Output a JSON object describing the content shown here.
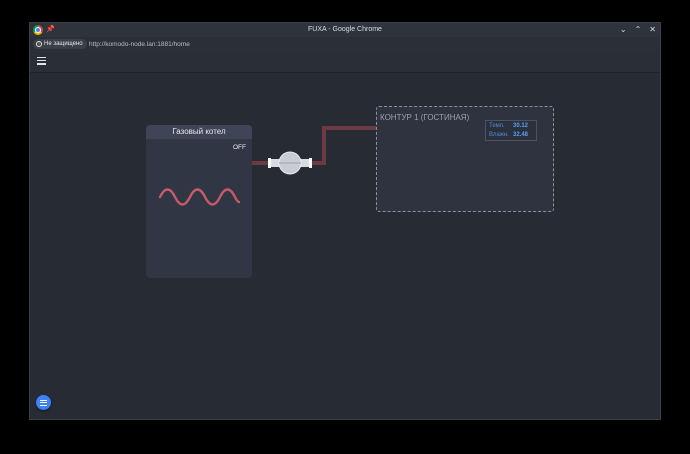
{
  "window": {
    "title": "FUXA - Google Chrome",
    "controls": {
      "minimize": "⌄",
      "restore": "⌃",
      "close": "✕"
    }
  },
  "addressbar": {
    "security_label": "Не защищено",
    "security_icon": "info-circle-icon",
    "url": "http://komodo-node.lan:1881/home"
  },
  "toolbar": {
    "menu_icon": "hamburger-menu-icon"
  },
  "boiler": {
    "title": "Газовый котел",
    "status": "OFF"
  },
  "contour": {
    "title": "КОНТУР 1 (ГОСТИНАЯ)",
    "sensors": [
      {
        "label": "Темп.",
        "value": "30.12"
      },
      {
        "label": "Влажн.",
        "value": "32.48"
      }
    ]
  },
  "colors": {
    "pipe": "#6e3a42",
    "wave": "#c75a67",
    "accent": "#3b82f6",
    "sensor_value": "#5aa0f0"
  },
  "fab_icon": "menu-list-icon"
}
